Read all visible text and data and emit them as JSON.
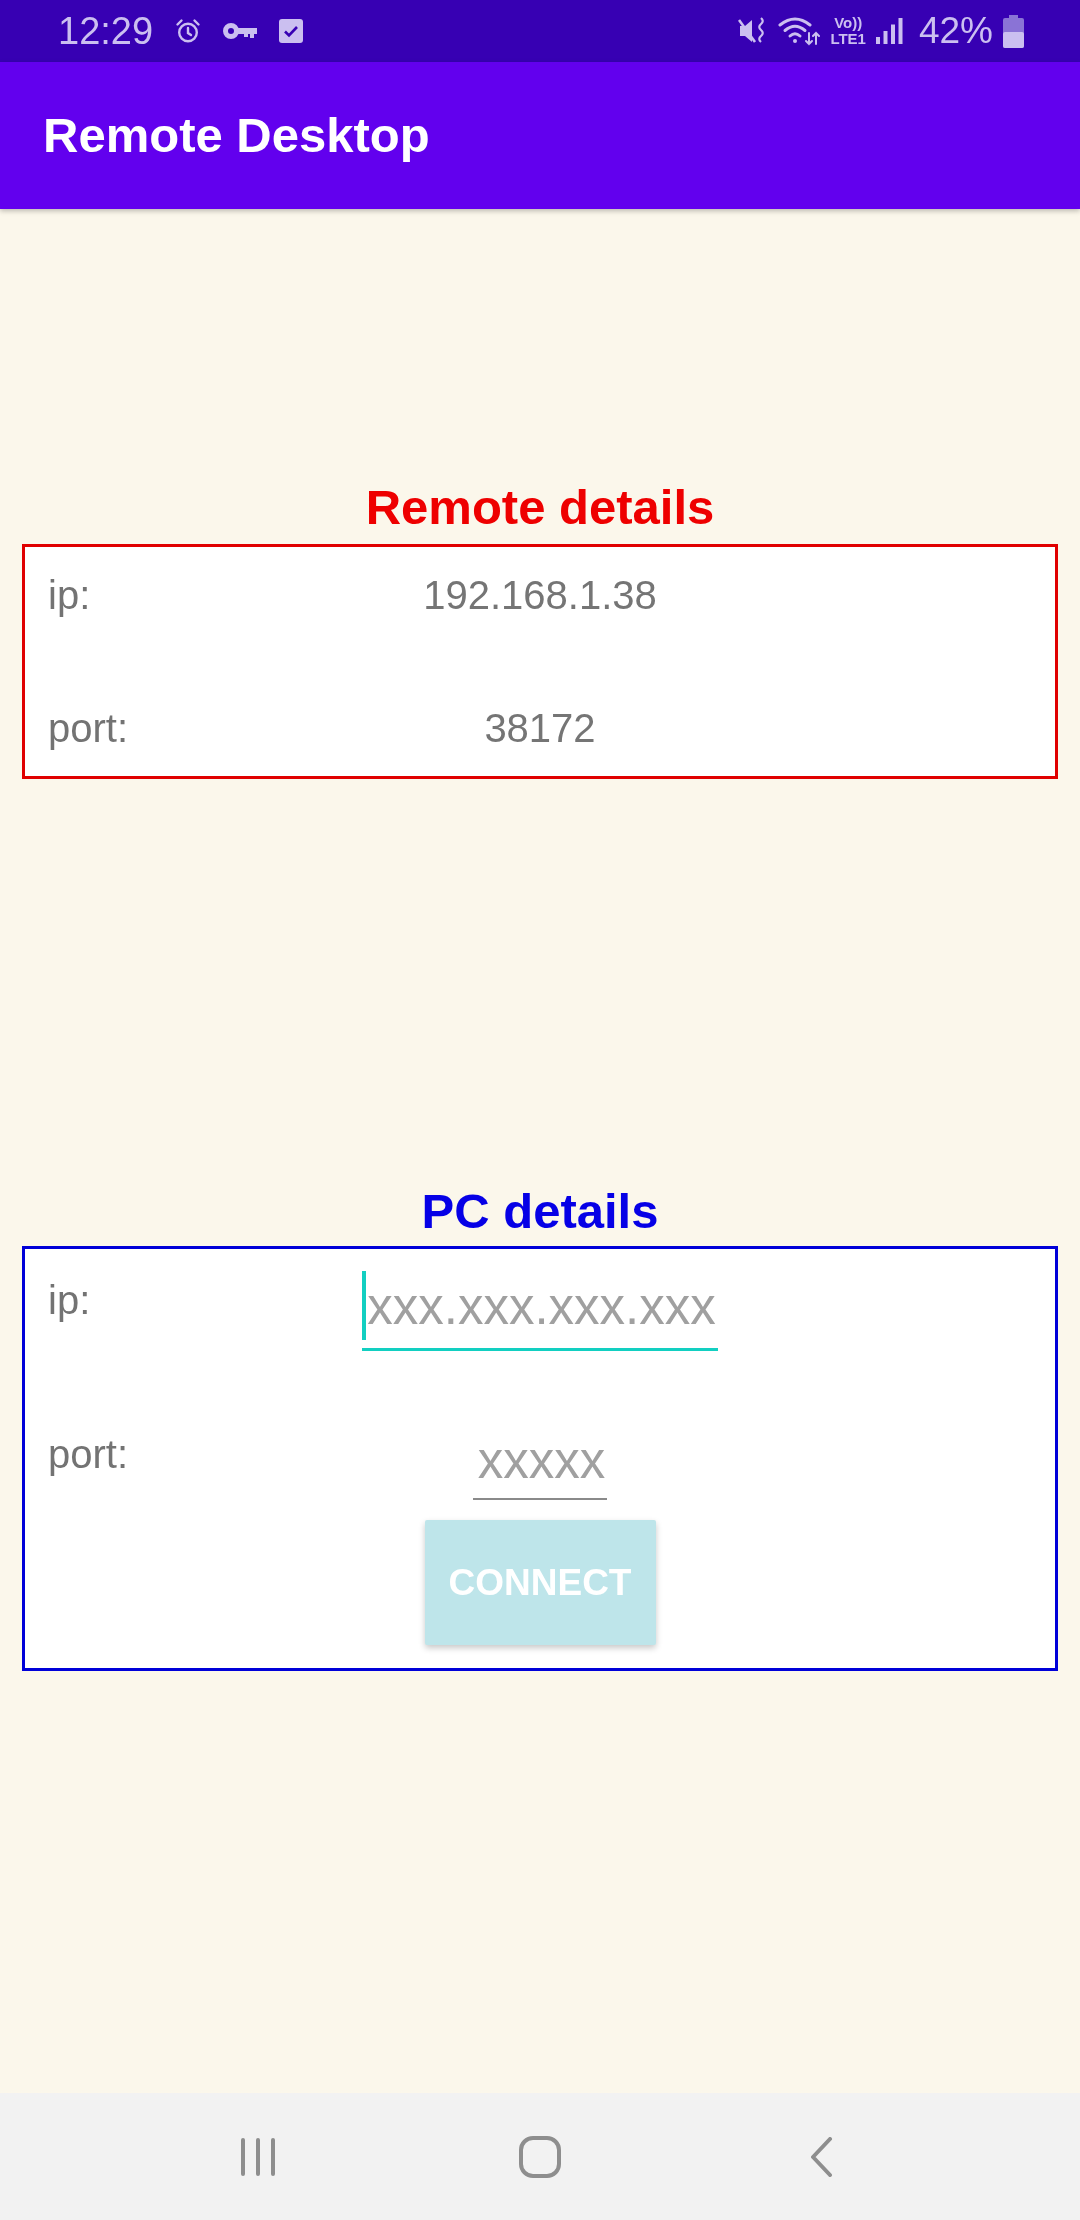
{
  "status_bar": {
    "time": "12:29",
    "network_label": [
      "Vo))",
      "LTE1"
    ],
    "battery": "42%"
  },
  "app_bar": {
    "title": "Remote Desktop"
  },
  "remote_details": {
    "title": "Remote details",
    "rows": [
      {
        "label": "ip:",
        "value": "192.168.1.38"
      },
      {
        "label": "port:",
        "value": "38172"
      }
    ]
  },
  "pc_details": {
    "title": "PC details",
    "fields": [
      {
        "label": "ip:",
        "placeholder": "xxx.xxx.xxx.xxx",
        "focused": true
      },
      {
        "label": "port:",
        "placeholder": "xxxxx",
        "focused": false
      }
    ],
    "button": {
      "label": "CONNECT",
      "disabled": true
    }
  }
}
